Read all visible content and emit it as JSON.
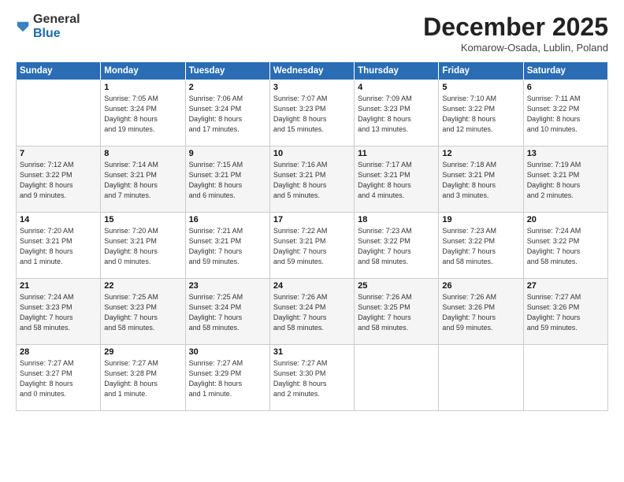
{
  "logo": {
    "general": "General",
    "blue": "Blue"
  },
  "header": {
    "month": "December 2025",
    "location": "Komarow-Osada, Lublin, Poland"
  },
  "weekdays": [
    "Sunday",
    "Monday",
    "Tuesday",
    "Wednesday",
    "Thursday",
    "Friday",
    "Saturday"
  ],
  "weeks": [
    {
      "days": [
        {
          "num": "",
          "info": ""
        },
        {
          "num": "1",
          "info": "Sunrise: 7:05 AM\nSunset: 3:24 PM\nDaylight: 8 hours\nand 19 minutes."
        },
        {
          "num": "2",
          "info": "Sunrise: 7:06 AM\nSunset: 3:24 PM\nDaylight: 8 hours\nand 17 minutes."
        },
        {
          "num": "3",
          "info": "Sunrise: 7:07 AM\nSunset: 3:23 PM\nDaylight: 8 hours\nand 15 minutes."
        },
        {
          "num": "4",
          "info": "Sunrise: 7:09 AM\nSunset: 3:23 PM\nDaylight: 8 hours\nand 13 minutes."
        },
        {
          "num": "5",
          "info": "Sunrise: 7:10 AM\nSunset: 3:22 PM\nDaylight: 8 hours\nand 12 minutes."
        },
        {
          "num": "6",
          "info": "Sunrise: 7:11 AM\nSunset: 3:22 PM\nDaylight: 8 hours\nand 10 minutes."
        }
      ]
    },
    {
      "days": [
        {
          "num": "7",
          "info": "Sunrise: 7:12 AM\nSunset: 3:22 PM\nDaylight: 8 hours\nand 9 minutes."
        },
        {
          "num": "8",
          "info": "Sunrise: 7:14 AM\nSunset: 3:21 PM\nDaylight: 8 hours\nand 7 minutes."
        },
        {
          "num": "9",
          "info": "Sunrise: 7:15 AM\nSunset: 3:21 PM\nDaylight: 8 hours\nand 6 minutes."
        },
        {
          "num": "10",
          "info": "Sunrise: 7:16 AM\nSunset: 3:21 PM\nDaylight: 8 hours\nand 5 minutes."
        },
        {
          "num": "11",
          "info": "Sunrise: 7:17 AM\nSunset: 3:21 PM\nDaylight: 8 hours\nand 4 minutes."
        },
        {
          "num": "12",
          "info": "Sunrise: 7:18 AM\nSunset: 3:21 PM\nDaylight: 8 hours\nand 3 minutes."
        },
        {
          "num": "13",
          "info": "Sunrise: 7:19 AM\nSunset: 3:21 PM\nDaylight: 8 hours\nand 2 minutes."
        }
      ]
    },
    {
      "days": [
        {
          "num": "14",
          "info": "Sunrise: 7:20 AM\nSunset: 3:21 PM\nDaylight: 8 hours\nand 1 minute."
        },
        {
          "num": "15",
          "info": "Sunrise: 7:20 AM\nSunset: 3:21 PM\nDaylight: 8 hours\nand 0 minutes."
        },
        {
          "num": "16",
          "info": "Sunrise: 7:21 AM\nSunset: 3:21 PM\nDaylight: 7 hours\nand 59 minutes."
        },
        {
          "num": "17",
          "info": "Sunrise: 7:22 AM\nSunset: 3:21 PM\nDaylight: 7 hours\nand 59 minutes."
        },
        {
          "num": "18",
          "info": "Sunrise: 7:23 AM\nSunset: 3:22 PM\nDaylight: 7 hours\nand 58 minutes."
        },
        {
          "num": "19",
          "info": "Sunrise: 7:23 AM\nSunset: 3:22 PM\nDaylight: 7 hours\nand 58 minutes."
        },
        {
          "num": "20",
          "info": "Sunrise: 7:24 AM\nSunset: 3:22 PM\nDaylight: 7 hours\nand 58 minutes."
        }
      ]
    },
    {
      "days": [
        {
          "num": "21",
          "info": "Sunrise: 7:24 AM\nSunset: 3:23 PM\nDaylight: 7 hours\nand 58 minutes."
        },
        {
          "num": "22",
          "info": "Sunrise: 7:25 AM\nSunset: 3:23 PM\nDaylight: 7 hours\nand 58 minutes."
        },
        {
          "num": "23",
          "info": "Sunrise: 7:25 AM\nSunset: 3:24 PM\nDaylight: 7 hours\nand 58 minutes."
        },
        {
          "num": "24",
          "info": "Sunrise: 7:26 AM\nSunset: 3:24 PM\nDaylight: 7 hours\nand 58 minutes."
        },
        {
          "num": "25",
          "info": "Sunrise: 7:26 AM\nSunset: 3:25 PM\nDaylight: 7 hours\nand 58 minutes."
        },
        {
          "num": "26",
          "info": "Sunrise: 7:26 AM\nSunset: 3:26 PM\nDaylight: 7 hours\nand 59 minutes."
        },
        {
          "num": "27",
          "info": "Sunrise: 7:27 AM\nSunset: 3:26 PM\nDaylight: 7 hours\nand 59 minutes."
        }
      ]
    },
    {
      "days": [
        {
          "num": "28",
          "info": "Sunrise: 7:27 AM\nSunset: 3:27 PM\nDaylight: 8 hours\nand 0 minutes."
        },
        {
          "num": "29",
          "info": "Sunrise: 7:27 AM\nSunset: 3:28 PM\nDaylight: 8 hours\nand 1 minute."
        },
        {
          "num": "30",
          "info": "Sunrise: 7:27 AM\nSunset: 3:29 PM\nDaylight: 8 hours\nand 1 minute."
        },
        {
          "num": "31",
          "info": "Sunrise: 7:27 AM\nSunset: 3:30 PM\nDaylight: 8 hours\nand 2 minutes."
        },
        {
          "num": "",
          "info": ""
        },
        {
          "num": "",
          "info": ""
        },
        {
          "num": "",
          "info": ""
        }
      ]
    }
  ]
}
